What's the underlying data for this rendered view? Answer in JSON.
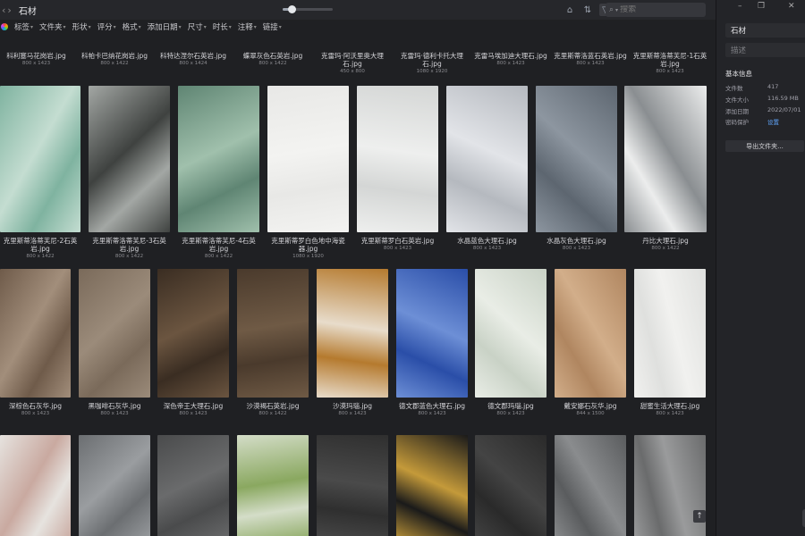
{
  "window": {
    "title": "石材"
  },
  "topbar": {
    "search_placeholder": "搜索",
    "search_icon": "magnifier-icon",
    "zoom_level": 0.17
  },
  "filters": [
    {
      "label": "标签"
    },
    {
      "label": "文件夹"
    },
    {
      "label": "形状"
    },
    {
      "label": "评分"
    },
    {
      "label": "格式"
    },
    {
      "label": "添加日期"
    },
    {
      "label": "尺寸"
    },
    {
      "label": "时长"
    },
    {
      "label": "注释"
    },
    {
      "label": "链接"
    }
  ],
  "rows": [
    {
      "items": [
        {
          "name": "科利塞马花岗岩.jpg",
          "dims": "800 x 1423",
          "colors": [
            "#2c2b2a",
            "#6a6866"
          ]
        },
        {
          "name": "科帕卡巴纳花岗岩.jpg",
          "dims": "800 x 1422",
          "colors": [
            "#d8d8d6",
            "#3a3a3a"
          ]
        },
        {
          "name": "科特达涅尔石英岩.jpg",
          "dims": "800 x 1424",
          "colors": [
            "#c6c2bb",
            "#8e8a85"
          ]
        },
        {
          "name": "蝶翠灰色石英岩.jpg",
          "dims": "800 x 1422",
          "colors": [
            "#8a8f8c",
            "#c9cbc8"
          ]
        },
        {
          "name": "克雷玛·阿沃里奥大理石.jpg",
          "dims": "450 x 800",
          "colors": [
            "#a8a49d",
            "#d6d1c8"
          ]
        },
        {
          "name": "克雷玛·德利卡托大理石.jpg",
          "dims": "1080 x 1920",
          "colors": [
            "#e5e0d8",
            "#f4f1ec"
          ]
        },
        {
          "name": "克雷马埃加迪大理石.jpg",
          "dims": "800 x 1423",
          "colors": [
            "#d8cbb9",
            "#b9a88f"
          ]
        },
        {
          "name": "克里斯蒂洛蓝石英岩.jpg",
          "dims": "800 x 1423",
          "colors": [
            "#8b95a7",
            "#d4d9e3"
          ]
        },
        {
          "name": "克里斯蒂洛蒂芙尼-1石英岩.jpg",
          "dims": "800 x 1423",
          "colors": [
            "#3a3c3b",
            "#c8d2cd"
          ]
        }
      ]
    },
    {
      "items": [
        {
          "name": "克里斯蒂洛蒂芙尼-2石英岩.jpg",
          "dims": "800 x 1422",
          "colors": [
            "#7fb3a0",
            "#c4ddd1"
          ]
        },
        {
          "name": "克里斯蒂洛蒂芙尼-3石英岩.jpg",
          "dims": "800 x 1422",
          "colors": [
            "#a3a7a4",
            "#3f4240"
          ]
        },
        {
          "name": "克里斯蒂洛蒂芙尼-4石英岩.jpg",
          "dims": "800 x 1422",
          "colors": [
            "#5f8573",
            "#a0c0ac"
          ]
        },
        {
          "name": "克里斯蒂罗白色地中海瓷器.jpg",
          "dims": "1080 x 1920",
          "colors": [
            "#e8e8e6",
            "#f3f3f1"
          ]
        },
        {
          "name": "克里斯蒂罗白石英岩.jpg",
          "dims": "800 x 1423",
          "colors": [
            "#d4d6d5",
            "#eeefee"
          ]
        },
        {
          "name": "水晶蓝色大理石.jpg",
          "dims": "800 x 1423",
          "colors": [
            "#b5b9bf",
            "#e2e4e8"
          ]
        },
        {
          "name": "水晶灰色大理石.jpg",
          "dims": "800 x 1423",
          "colors": [
            "#5d6670",
            "#8d96a0"
          ]
        },
        {
          "name": "丹比大理石.jpg",
          "dims": "800 x 1422",
          "colors": [
            "#eceded",
            "#8a8e91"
          ]
        }
      ]
    },
    {
      "items": [
        {
          "name": "深棕色石灰华.jpg",
          "dims": "800 x 1423",
          "colors": [
            "#6f5b4a",
            "#a28e7b"
          ]
        },
        {
          "name": "黑咖啡石灰华.jpg",
          "dims": "800 x 1423",
          "colors": [
            "#7a6a5a",
            "#9b8b7a"
          ]
        },
        {
          "name": "深色帝王大理石.jpg",
          "dims": "800 x 1423",
          "colors": [
            "#3a2d22",
            "#6b5540"
          ]
        },
        {
          "name": "沙漠褐石英岩.jpg",
          "dims": "800 x 1422",
          "colors": [
            "#4a3a2c",
            "#6f5a45"
          ]
        },
        {
          "name": "沙漠玛瑙.jpg",
          "dims": "800 x 1423",
          "colors": [
            "#b57a2e",
            "#e8dccb"
          ]
        },
        {
          "name": "德文郡蓝色大理石.jpg",
          "dims": "800 x 1423",
          "colors": [
            "#2a4ea8",
            "#6d8fd6"
          ]
        },
        {
          "name": "德文郡玛瑙.jpg",
          "dims": "800 x 1423",
          "colors": [
            "#c9d2c6",
            "#e9ede6"
          ]
        },
        {
          "name": "戴安娜石灰华.jpg",
          "dims": "844 x 1500",
          "colors": [
            "#b08660",
            "#d2ae8a"
          ]
        },
        {
          "name": "甜蜜生活大理石.jpg",
          "dims": "800 x 1423",
          "colors": [
            "#dfe0de",
            "#f1f1ef"
          ]
        }
      ]
    },
    {
      "items": [
        {
          "name": "",
          "dims": "",
          "colors": [
            "#e6e3df",
            "#c9a9a0"
          ]
        },
        {
          "name": "",
          "dims": "",
          "colors": [
            "#6b6e71",
            "#9a9da0"
          ]
        },
        {
          "name": "",
          "dims": "",
          "colors": [
            "#4a4b4c",
            "#6a6b6c"
          ]
        },
        {
          "name": "",
          "dims": "",
          "colors": [
            "#d4ddc8",
            "#8aa860"
          ]
        },
        {
          "name": "",
          "dims": "",
          "colors": [
            "#2f2f2f",
            "#4a4a4a"
          ]
        },
        {
          "name": "",
          "dims": "",
          "colors": [
            "#1a1a1a",
            "#c49a3a"
          ]
        },
        {
          "name": "",
          "dims": "",
          "colors": [
            "#2a2a2a",
            "#444"
          ]
        },
        {
          "name": "",
          "dims": "",
          "colors": [
            "#5a5c5e",
            "#8a8c8e"
          ]
        },
        {
          "name": "",
          "dims": "",
          "colors": [
            "#6a6b6c",
            "#9a9b9c"
          ]
        }
      ]
    }
  ],
  "sidebar": {
    "folder_name": "石材",
    "description_placeholder": "描述",
    "section_title": "基本信息",
    "info": [
      {
        "label": "文件数",
        "value": "417"
      },
      {
        "label": "文件大小",
        "value": "116.59 MB"
      },
      {
        "label": "添加日期",
        "value": "2022/07/01"
      },
      {
        "label": "密码保护",
        "value": "设置"
      }
    ],
    "export_button": "导出文件夹..."
  }
}
